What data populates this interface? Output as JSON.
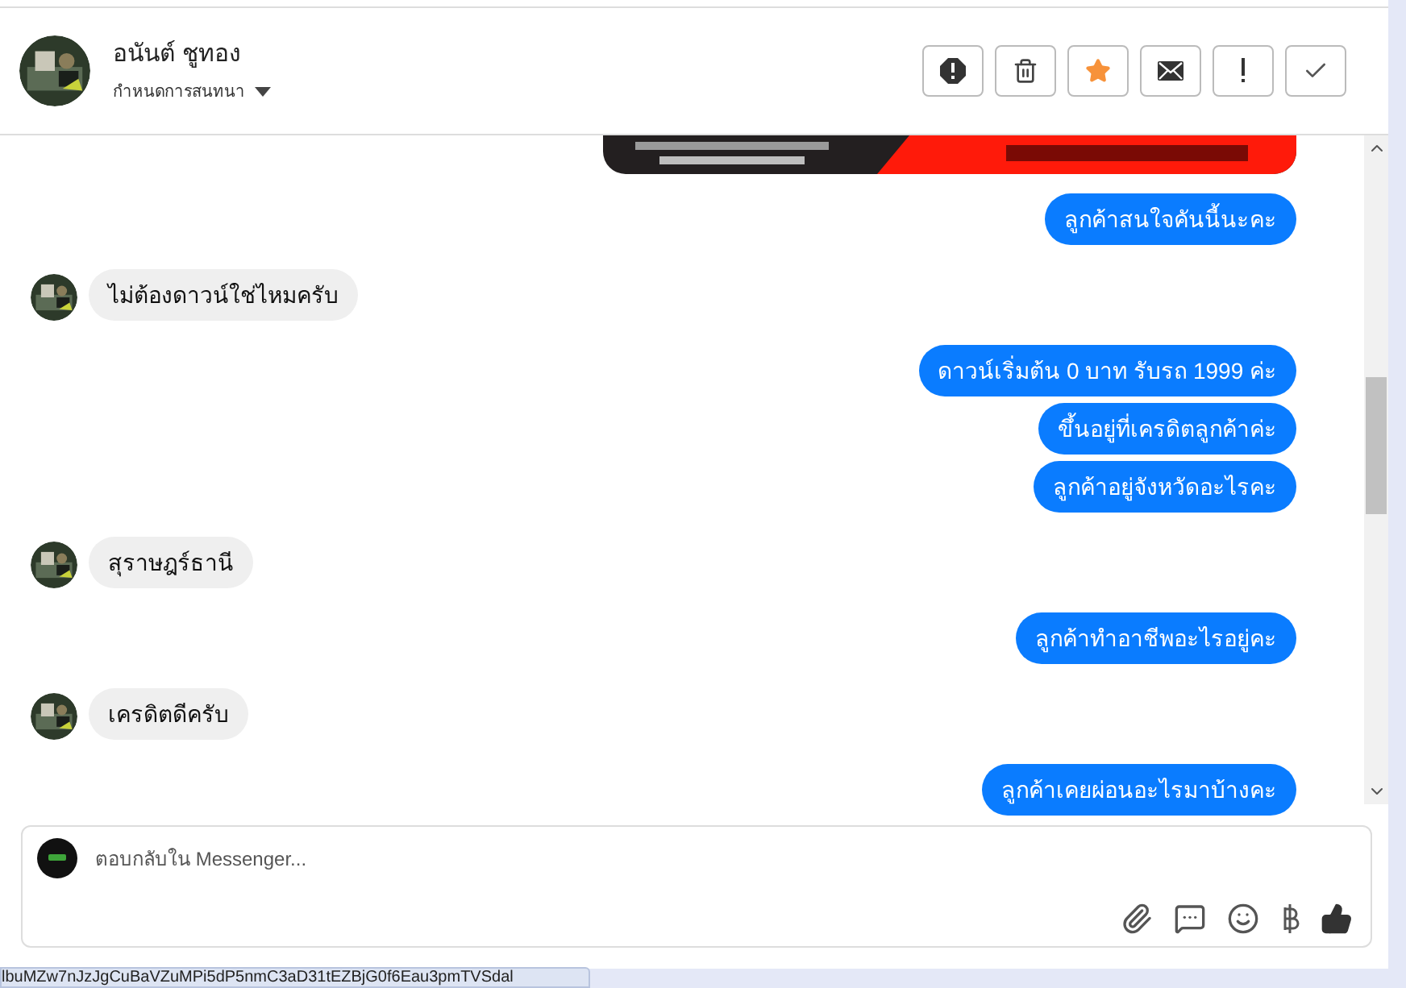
{
  "header": {
    "name": "อนันต์ ชูทอง",
    "subtitle": "กำหนดการสนทนา",
    "actions": [
      {
        "kind": "alert"
      },
      {
        "kind": "trash"
      },
      {
        "kind": "star"
      },
      {
        "kind": "mail"
      },
      {
        "kind": "bang"
      },
      {
        "kind": "check"
      }
    ]
  },
  "thread": {
    "groups": [
      {
        "kind": "outgoing",
        "messages": [
          "ลูกค้าสนใจคันนี้นะคะ"
        ]
      },
      {
        "kind": "incoming",
        "messages": [
          "ไม่ต้องดาวน์ใช่ไหมครับ"
        ]
      },
      {
        "kind": "outgoing",
        "messages": [
          "ดาวน์เริ่มต้น 0 บาท รับรถ 1999 ค่ะ",
          "ขึ้นอยู่ที่เครดิตลูกค้าค่ะ",
          "ลูกค้าอยู่จังหวัดอะไรคะ"
        ]
      },
      {
        "kind": "incoming",
        "messages": [
          "สุราษฎร์ธานี"
        ]
      },
      {
        "kind": "outgoing",
        "messages": [
          "ลูกค้าทำอาชีพอะไรอยู่คะ"
        ]
      },
      {
        "kind": "incoming",
        "messages": [
          "เครดิตดีครับ"
        ]
      },
      {
        "kind": "outgoing",
        "messages": [
          "ลูกค้าเคยผ่อนอะไรมาบ้างคะ"
        ]
      }
    ]
  },
  "composer": {
    "placeholder": "ตอบกลับใน Messenger...",
    "tools": [
      {
        "kind": "attach"
      },
      {
        "kind": "chat"
      },
      {
        "kind": "emoji"
      },
      {
        "kind": "baht"
      },
      {
        "kind": "like"
      }
    ]
  },
  "status_url": "lbuMZw7nJzJgCuBaVZuMPi5dP5nmC3aD31tEZBjG0f6Eau3pmTVSdal"
}
